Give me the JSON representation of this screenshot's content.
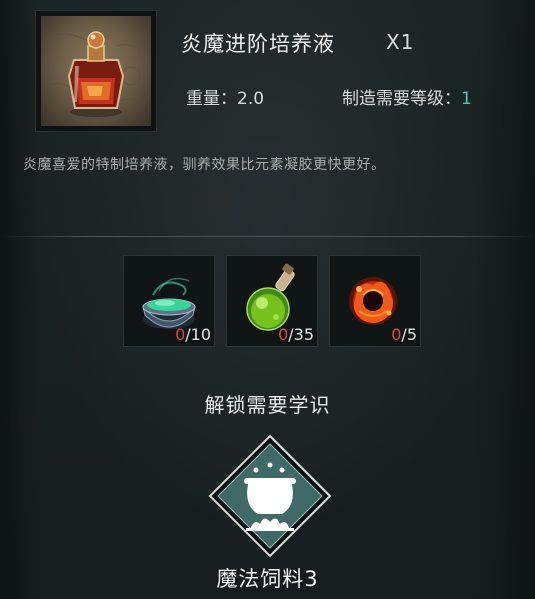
{
  "item": {
    "name": "炎魔进阶培养液",
    "quantity": "X1",
    "icon": "flask-potion-icon",
    "weight_label": "重量：",
    "weight_value": "2.0",
    "craft_level_label": "制造需要等级：",
    "craft_level_value": "1",
    "description": "炎魔喜爱的特制培养液，驯养效果比元素凝胶更快更好。"
  },
  "materials": [
    {
      "icon": "green-gel-bowl-icon",
      "have": "0",
      "need": "/10"
    },
    {
      "icon": "green-potion-flask-icon",
      "have": "0",
      "need": "/35"
    },
    {
      "icon": "fire-core-icon",
      "have": "0",
      "need": "/5"
    }
  ],
  "unlock": {
    "heading": "解锁需要学识",
    "knowledge_icon": "cauldron-icon",
    "knowledge_name": "魔法饲料3"
  },
  "colors": {
    "accent_cyan": "#5fc1bf",
    "insufficient_red": "#e0463f",
    "badge_teal": "#3f6a66"
  }
}
